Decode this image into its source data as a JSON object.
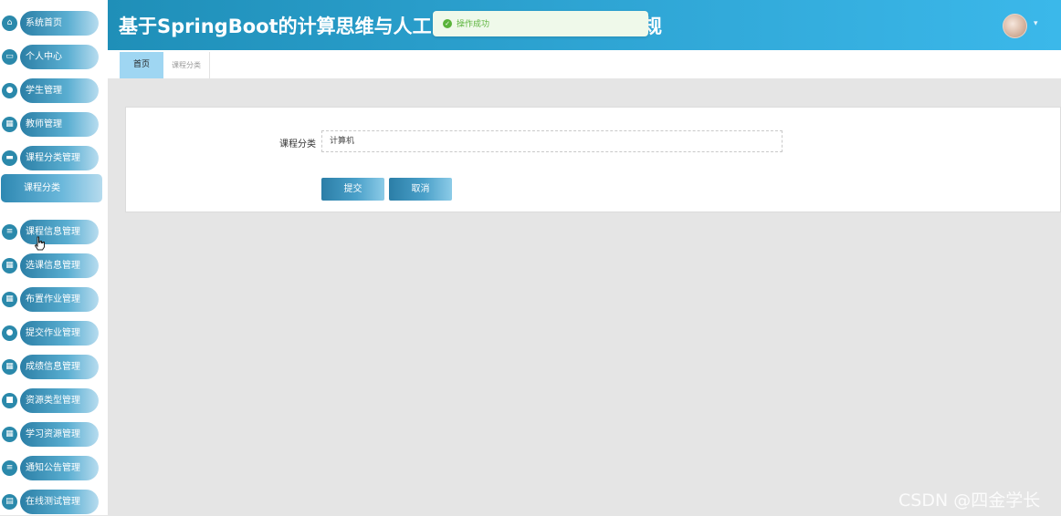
{
  "header": {
    "title_visible": "基于SpringBoot的计算思维与人工",
    "title_tail": "规",
    "toast": "操作成功"
  },
  "sidebar": {
    "items": [
      {
        "label": "系统首页",
        "icon": "home-icon"
      },
      {
        "label": "个人中心",
        "icon": "card-icon"
      },
      {
        "label": "学生管理",
        "icon": "user-icon"
      },
      {
        "label": "教师管理",
        "icon": "grid-icon"
      },
      {
        "label": "课程分类管理",
        "icon": "ticket-icon"
      },
      {
        "label": "课程信息管理",
        "icon": "list-icon"
      },
      {
        "label": "选课信息管理",
        "icon": "grid-icon"
      },
      {
        "label": "布置作业管理",
        "icon": "grid-icon"
      },
      {
        "label": "提交作业管理",
        "icon": "user-icon"
      },
      {
        "label": "成绩信息管理",
        "icon": "grid-icon"
      },
      {
        "label": "资源类型管理",
        "icon": "briefcase-icon"
      },
      {
        "label": "学习资源管理",
        "icon": "grid-icon"
      },
      {
        "label": "通知公告管理",
        "icon": "list-icon"
      },
      {
        "label": "在线测试管理",
        "icon": "doc-icon"
      }
    ],
    "submenu": {
      "label": "课程分类"
    }
  },
  "tabs": [
    {
      "label": "首页",
      "active": true
    },
    {
      "label": "课程分类",
      "active": false
    }
  ],
  "form": {
    "label": "课程分类",
    "value": "计算机",
    "submit": "提交",
    "cancel": "取消"
  },
  "watermark": "CSDN @四金学长",
  "colors": {
    "header": "#2ea4d3",
    "active_tab": "#9fd6f2",
    "toast_text": "#5cb43d",
    "button": "#2b7ea7"
  }
}
